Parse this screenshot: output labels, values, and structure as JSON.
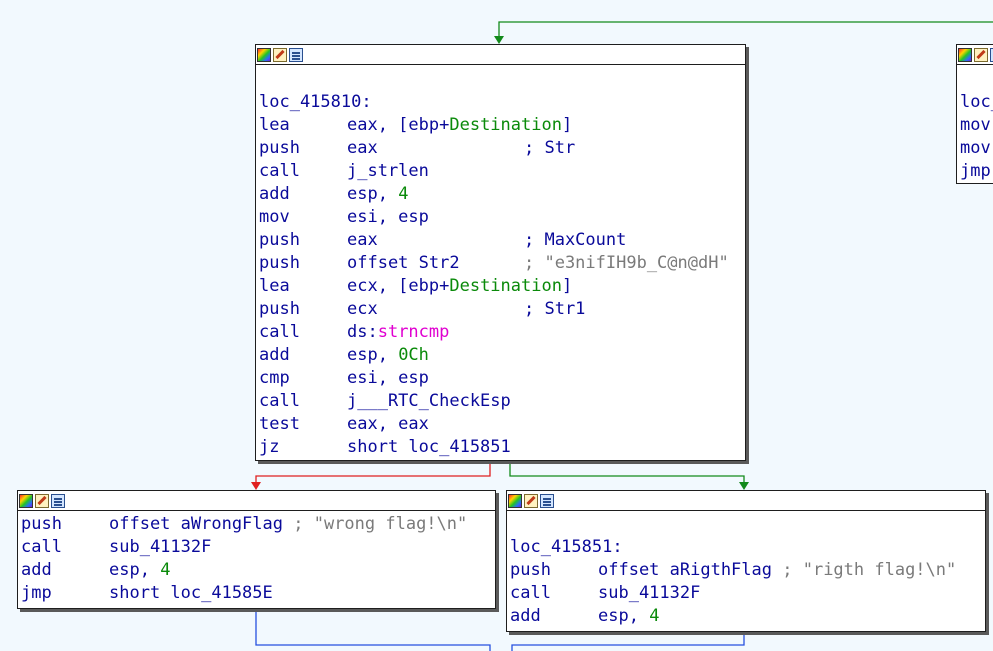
{
  "colors": {
    "background": "#f2f9fe",
    "edge_true": "#138a1b",
    "edge_false": "#e02020",
    "edge_jump": "#2650e0"
  },
  "header_icons": [
    "color-picker-icon",
    "edit-icon",
    "graph-icon"
  ],
  "main_block": {
    "label": "loc_415810:",
    "lines": {
      "l1": {
        "mn": "lea",
        "a": "eax, [ebp+",
        "b": "Destination",
        "c": "]"
      },
      "l2": {
        "mn": "push",
        "a": "eax",
        "cmt": "; Str"
      },
      "l3": {
        "mn": "call",
        "a": "j_strlen"
      },
      "l4": {
        "mn": "add",
        "a": "esp, ",
        "num": "4"
      },
      "l5": {
        "mn": "mov",
        "a": "esi, esp"
      },
      "l6": {
        "mn": "push",
        "a": "eax",
        "cmt": "; MaxCount"
      },
      "l7": {
        "mn": "push",
        "a": "offset Str2",
        "cmt": "; \"e3nifIH9b_C@n@dH\""
      },
      "l8": {
        "mn": "lea",
        "a": "ecx, [ebp+",
        "b": "Destination",
        "c": "]"
      },
      "l9": {
        "mn": "push",
        "a": "ecx",
        "cmt": "; Str1"
      },
      "l10": {
        "mn": "call",
        "a": "ds:",
        "imp": "strncmp"
      },
      "l11": {
        "mn": "add",
        "a": "esp, ",
        "num": "0Ch"
      },
      "l12": {
        "mn": "cmp",
        "a": "esi, esp"
      },
      "l13": {
        "mn": "call",
        "a": "j___RTC_CheckEsp"
      },
      "l14": {
        "mn": "test",
        "a": "eax, eax"
      },
      "l15": {
        "mn": "jz",
        "a": "short loc_415851"
      }
    }
  },
  "wrong_block": {
    "l1": {
      "mn": "push",
      "a": "offset aWrongFlag",
      "cmt": "; \"wrong flag!\\n\""
    },
    "l2": {
      "mn": "call",
      "a": "sub_41132F"
    },
    "l3": {
      "mn": "add",
      "a": "esp, ",
      "num": "4"
    },
    "l4": {
      "mn": "jmp",
      "a": "short loc_41585E"
    }
  },
  "right_block": {
    "label": "loc_415851:",
    "l1": {
      "mn": "push",
      "a": "offset aRigthFlag",
      "cmt": "; \"rigth flag!\\n\""
    },
    "l2": {
      "mn": "call",
      "a": "sub_41132F"
    },
    "l3": {
      "mn": "add",
      "a": "esp, ",
      "num": "4"
    }
  },
  "side_block": {
    "label": "loc_",
    "m1": "mov",
    "m2": "mov",
    "m3": "jmp"
  }
}
